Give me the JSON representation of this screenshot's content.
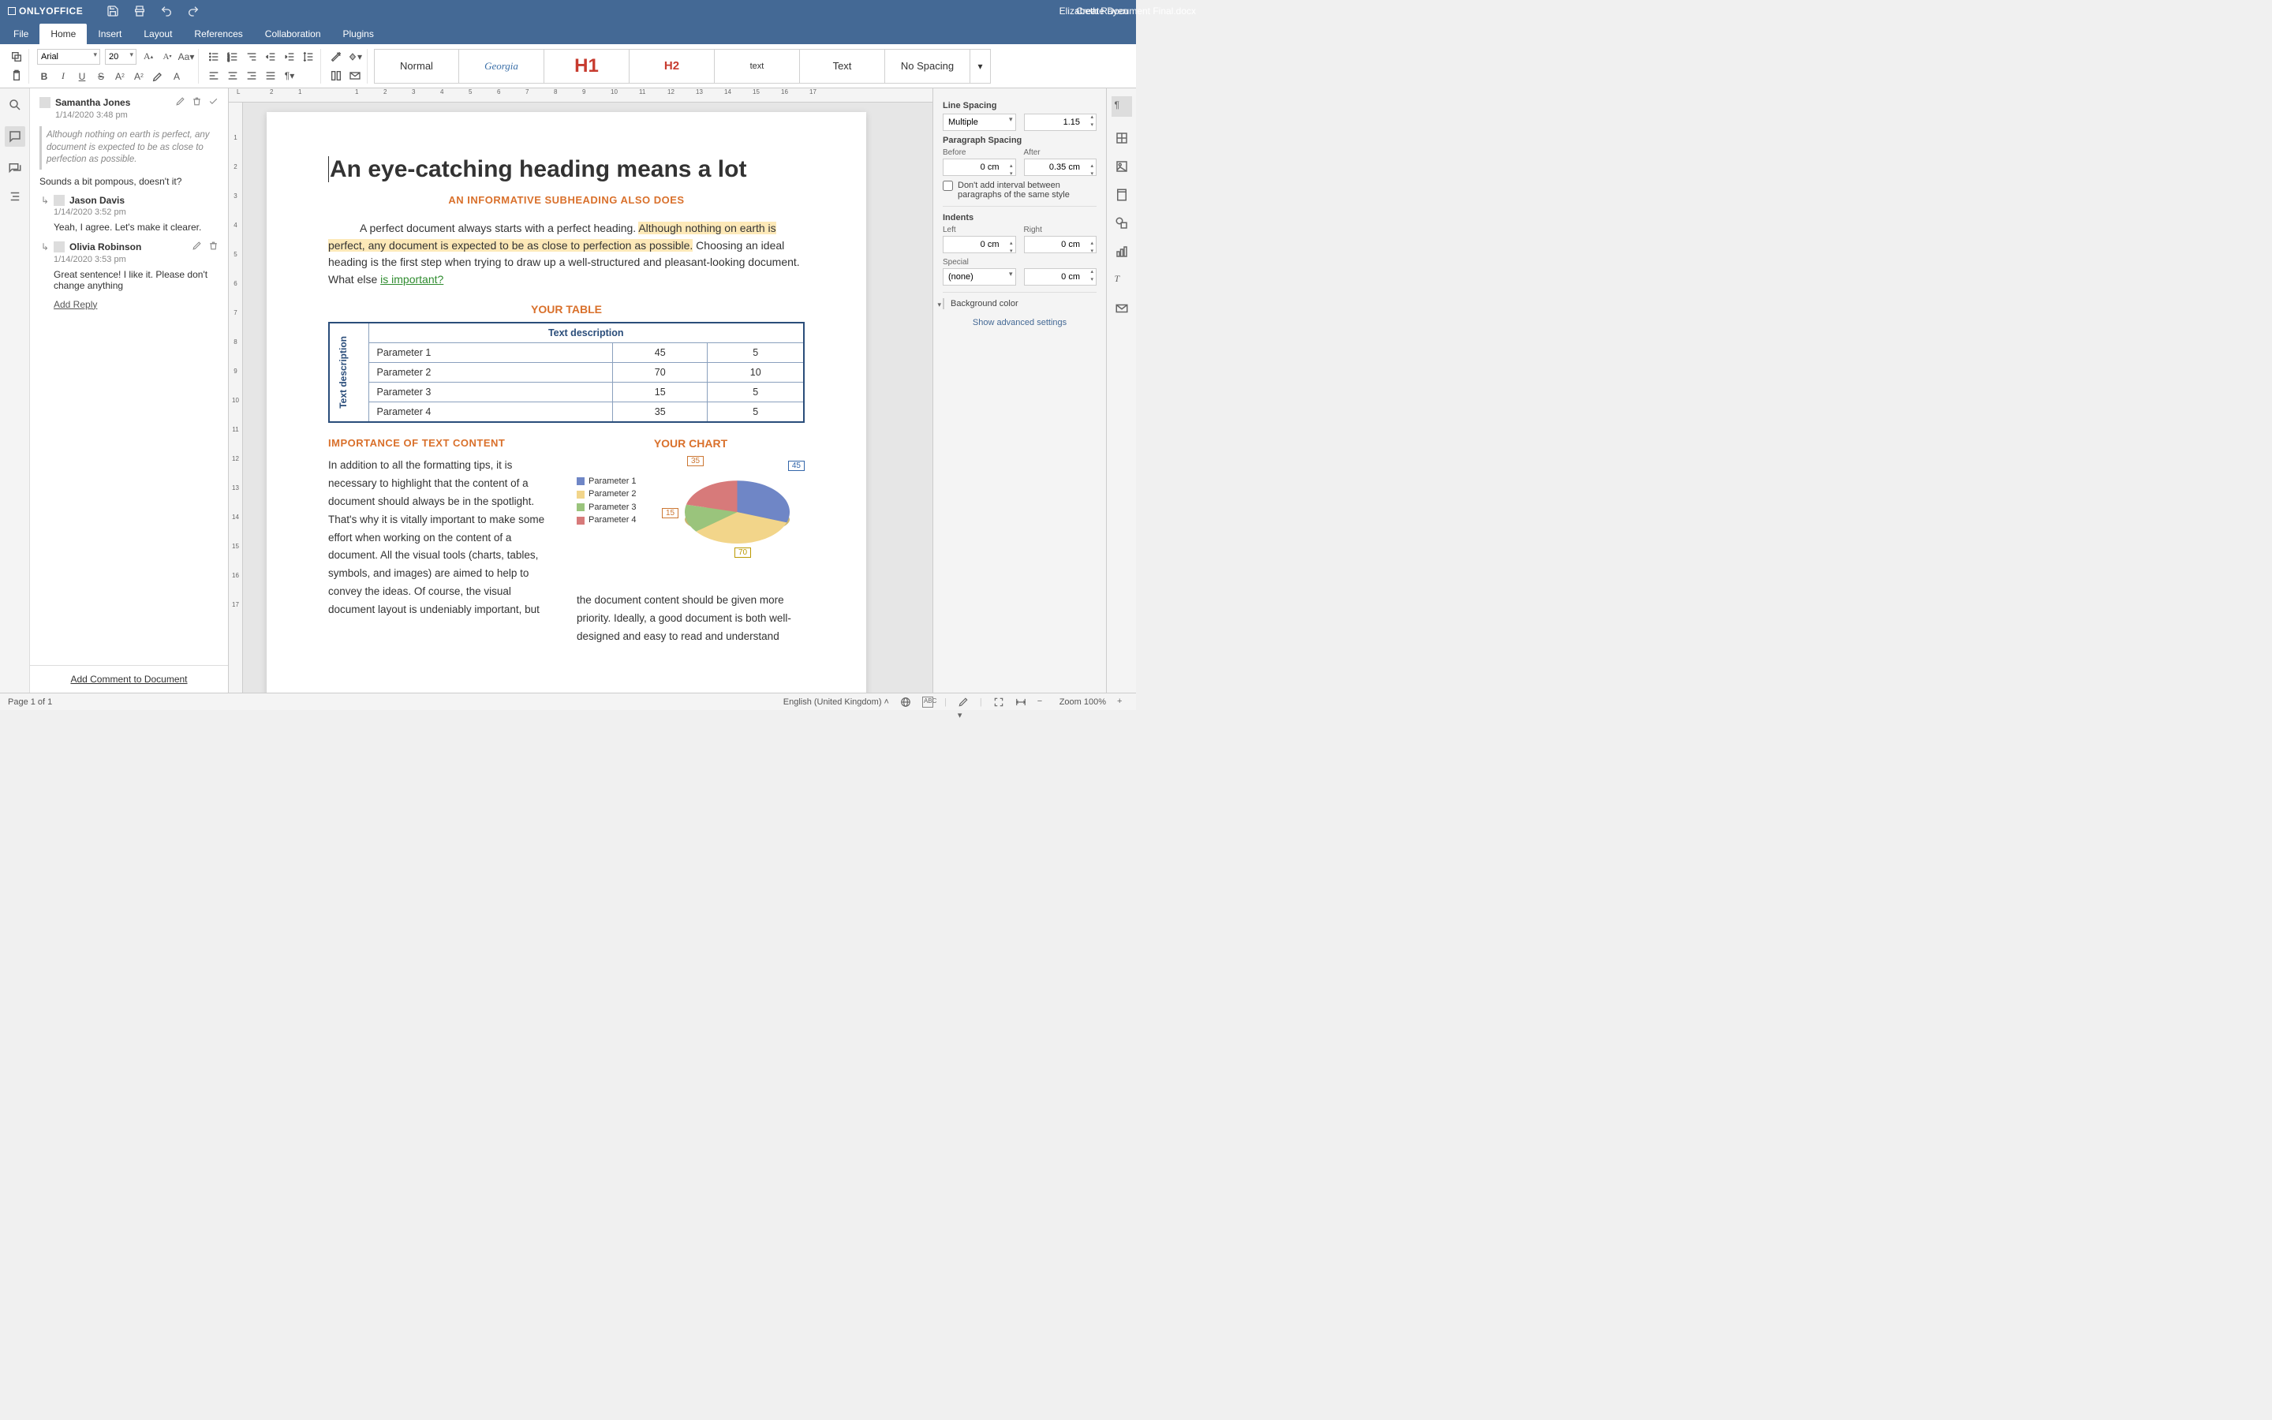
{
  "app": {
    "name": "ONLYOFFICE",
    "doc_title": "Create Document Final.docx",
    "user": "Elizabeth Rayen"
  },
  "menu": {
    "file": "File",
    "home": "Home",
    "insert": "Insert",
    "layout": "Layout",
    "references": "References",
    "collaboration": "Collaboration",
    "plugins": "Plugins"
  },
  "ribbon": {
    "font": "Arial",
    "size": "20",
    "styles": [
      "Normal",
      "Georgia",
      "H1",
      "H2",
      "text",
      "Text",
      "No Spacing"
    ]
  },
  "comments": {
    "thread": {
      "author": "Samantha Jones",
      "date": "1/14/2020 3:48 pm",
      "quote": "Although nothing on earth is perfect, any document is expected to be as close to perfection as possible.",
      "body": "Sounds a bit pompous, doesn't it?"
    },
    "replies": [
      {
        "author": "Jason Davis",
        "date": "1/14/2020 3:52 pm",
        "body": "Yeah, I agree. Let's make it clearer."
      },
      {
        "author": "Olivia Robinson",
        "date": "1/14/2020 3:53 pm",
        "body": "Great sentence! I like it. Please don't change anything"
      }
    ],
    "add_reply": "Add Reply",
    "add_comment": "Add Comment to Document"
  },
  "doc": {
    "h1": "An eye-catching heading means a lot",
    "sub": "AN INFORMATIVE SUBHEADING ALSO DOES",
    "p1a": "A perfect document always starts with a perfect heading. ",
    "p1b": "Although nothing on earth is perfect, any document is expected to be as close to perfection as possible.",
    "p1c": " Choosing an ideal heading is the first step when trying to draw up a well-structured and pleasant-looking document. What else  ",
    "p1link": "is important?",
    "sec_table": "YOUR TABLE",
    "th_top": "Text description",
    "th_left": "Text description",
    "rows": [
      {
        "p": "Parameter 1",
        "a": "45",
        "b": "5"
      },
      {
        "p": "Parameter 2",
        "a": "70",
        "b": "10"
      },
      {
        "p": "Parameter 3",
        "a": "15",
        "b": "5"
      },
      {
        "p": "Parameter 4",
        "a": "35",
        "b": "5"
      }
    ],
    "sec_imp": "IMPORTANCE OF TEXT CONTENT",
    "imp_p": "In addition to all the formatting tips, it is necessary to highlight that the content of a document should always be in the spotlight. That's why it is vitally important to make some effort when working on the content of a document. All the visual tools (charts, tables, symbols, and images) are aimed to help to convey the ideas. Of course, the visual document layout is undeniably important, but",
    "chart_title": "YOUR CHART",
    "right_p": "the document content should be given more priority. Ideally, a good document is both well-designed and easy to read and understand"
  },
  "chart_data": {
    "type": "pie",
    "title": "YOUR CHART",
    "series": [
      {
        "name": "Parameter 1",
        "value": 45,
        "color": "#6f86c6"
      },
      {
        "name": "Parameter 2",
        "value": 70,
        "color": "#f2d58a"
      },
      {
        "name": "Parameter 3",
        "value": 15,
        "color": "#9ac47c"
      },
      {
        "name": "Parameter 4",
        "value": 35,
        "color": "#d77a7a"
      }
    ]
  },
  "panel": {
    "line_spacing": "Line Spacing",
    "ls_mode": "Multiple",
    "ls_val": "1.15",
    "para_spacing": "Paragraph Spacing",
    "before": "Before",
    "after": "After",
    "before_v": "0 cm",
    "after_v": "0.35 cm",
    "nointerval": "Don't add interval between paragraphs of the same style",
    "indents": "Indents",
    "left": "Left",
    "right": "Right",
    "left_v": "0 cm",
    "right_v": "0 cm",
    "special": "Special",
    "special_mode": "(none)",
    "special_v": "0 cm",
    "bgcolor": "Background color",
    "advanced": "Show advanced settings"
  },
  "status": {
    "page": "Page 1 of 1",
    "lang": "English (United Kingdom)",
    "zoom": "Zoom 100%"
  }
}
